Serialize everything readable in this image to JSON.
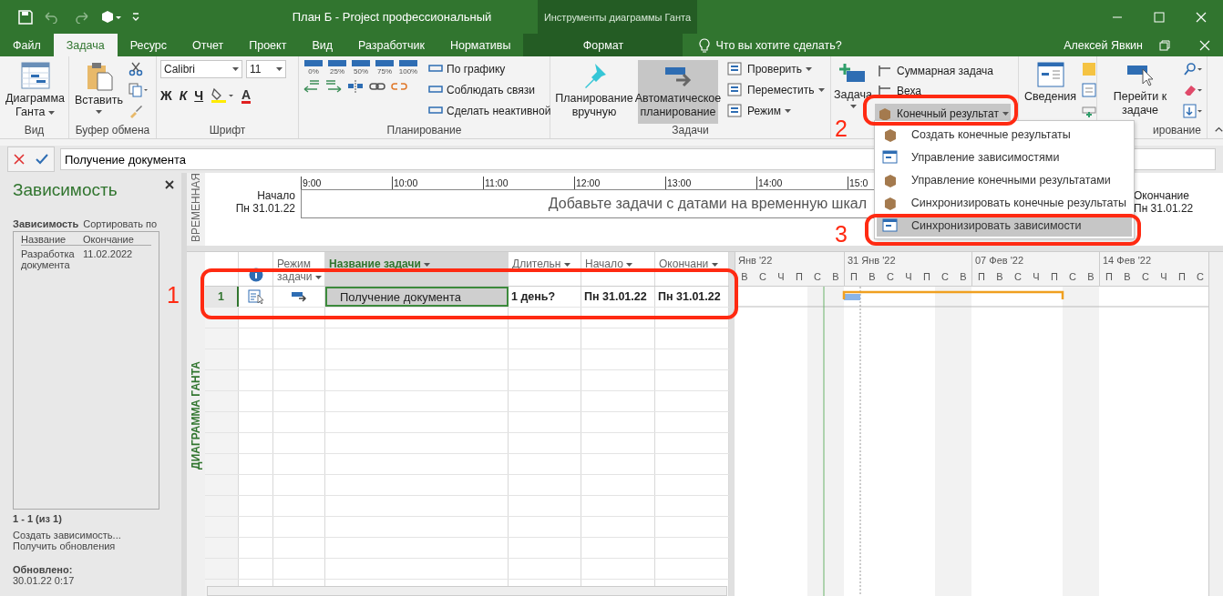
{
  "window": {
    "title": "План Б - Project профессиональный",
    "context_title": "Инструменты диаграммы Ганта"
  },
  "tabs": [
    {
      "label": "Файл",
      "selected": false,
      "kind": "file"
    },
    {
      "label": "Задача",
      "selected": true,
      "kind": "normal"
    },
    {
      "label": "Ресурс",
      "selected": false,
      "kind": "normal"
    },
    {
      "label": "Отчет",
      "selected": false,
      "kind": "normal"
    },
    {
      "label": "Проект",
      "selected": false,
      "kind": "normal"
    },
    {
      "label": "Вид",
      "selected": false,
      "kind": "normal"
    },
    {
      "label": "Разработчик",
      "selected": false,
      "kind": "normal"
    },
    {
      "label": "Нормативы",
      "selected": false,
      "kind": "normal"
    },
    {
      "label": "Формат",
      "selected": false,
      "kind": "context"
    }
  ],
  "tell_me": "Что вы хотите сделать?",
  "user": "Алексей Явкин",
  "ribbon": {
    "view": {
      "label": "Вид",
      "button": "Диаграмма Ганта"
    },
    "clipboard": {
      "label": "Буфер обмена",
      "paste": "Вставить"
    },
    "font": {
      "label": "Шрифт",
      "family": "Calibri",
      "size": "11",
      "bold": "Ж",
      "italic": "К",
      "underline": "Ч",
      "font_color": "A"
    },
    "schedule": {
      "label": "Планирование",
      "percent": [
        "0%",
        "25%",
        "50%",
        "75%",
        "100%"
      ],
      "commands": [
        "По графику",
        "Соблюдать связи",
        "Сделать неактивной"
      ]
    },
    "tasks": {
      "label": "Задачи",
      "modes": [
        {
          "label": "Планирование вручную",
          "selected": false
        },
        {
          "label": "Автоматическое планирование",
          "selected": true
        }
      ],
      "commands": [
        "Проверить",
        "Переместить",
        "Режим"
      ]
    },
    "insert": {
      "task": "Задача",
      "commands": [
        "Суммарная задача",
        "Веха"
      ],
      "deliverable": {
        "label": "Конечный результат",
        "expanded": true
      }
    },
    "properties": {
      "info": "Сведения"
    },
    "editing": {
      "label": "ирование",
      "goto": "Перейти к задаче"
    }
  },
  "formula_bar": {
    "value": "Получение документа"
  },
  "left_pane": {
    "title": "Зависимость",
    "filter_label": "Зависимость",
    "sort_label": "Сортировать по",
    "columns": [
      "Название",
      "Окончание"
    ],
    "rows": [
      {
        "name": "Разработка документа",
        "finish": "11.02.2022"
      }
    ],
    "count": "1 - 1 (из 1)",
    "links": [
      "Создать зависимость...",
      "Получить обновления"
    ],
    "updated_label": "Обновлено:",
    "updated": "30.01.22 0:17"
  },
  "timeline": {
    "label": "ВРЕМЕННАЯ",
    "start_label": "Начало",
    "start_date": "Пн 31.01.22",
    "hours": [
      "9:00",
      "10:00",
      "11:00",
      "12:00",
      "13:00",
      "14:00",
      "15:0"
    ],
    "placeholder": "Добавьте задачи с датами на временную шкал",
    "end_label": "Окончание",
    "end_date": "Пн 31.01.22"
  },
  "gantt": {
    "label": "ДИАГРАММА ГАНТА",
    "mode_header": "Режим задачи",
    "columns": [
      {
        "label": "Название задачи",
        "selected": true
      },
      {
        "label": "Длительн",
        "selected": false
      },
      {
        "label": "Начало",
        "selected": false
      },
      {
        "label": "Окончани",
        "selected": false
      }
    ],
    "rows": [
      {
        "id": "1",
        "cells": [
          "Получение документа",
          "1 день?",
          "Пн 31.01.22",
          "Пн 31.01.22"
        ],
        "selected": true
      }
    ],
    "weeks": [
      {
        "label": "Янв '22",
        "days": [
          "В",
          "С",
          "Ч",
          "П",
          "С",
          "В"
        ]
      },
      {
        "label": "31 Янв '22",
        "days": [
          "П",
          "В",
          "С",
          "Ч",
          "П",
          "С",
          "В"
        ]
      },
      {
        "label": "07 Фев '22",
        "days": [
          "П",
          "В",
          "С",
          "Ч",
          "П",
          "С",
          "В"
        ]
      },
      {
        "label": "14 Фев '22",
        "days": [
          "П",
          "В",
          "С",
          "Ч",
          "П",
          "С"
        ]
      }
    ]
  },
  "menu": {
    "items": [
      {
        "label": "Создать конечные результаты",
        "selected": false
      },
      {
        "label": "Управление зависимостями",
        "selected": false
      },
      {
        "label": "Управление конечными результатами",
        "selected": false
      },
      {
        "label": "Синхронизировать конечные результаты",
        "selected": false
      },
      {
        "label": "Синхронизировать зависимости",
        "selected": true
      }
    ]
  },
  "annotations": [
    "1",
    "2",
    "3"
  ]
}
